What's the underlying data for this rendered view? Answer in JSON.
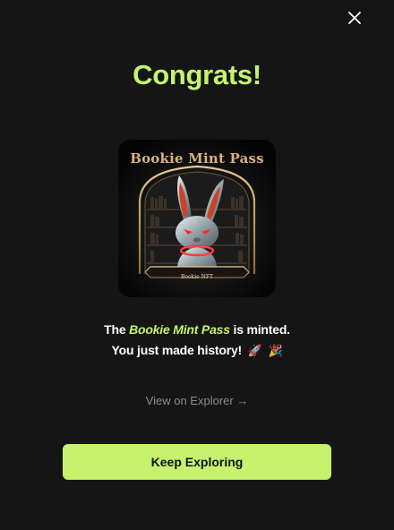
{
  "dialog": {
    "title": "Congrats!",
    "close_icon": "close-icon"
  },
  "nft": {
    "name": "Bookie Mint Pass",
    "banner_text": "Bookie NFT"
  },
  "message": {
    "prefix": "The",
    "highlight": "Bookie Mint Pass",
    "suffix": "is minted.",
    "line2": "You just made history!",
    "emoji_1": "🚀",
    "emoji_2": "🎉"
  },
  "links": {
    "explorer": "View on Explorer →"
  },
  "cta": {
    "label": "Keep Exploring"
  },
  "colors": {
    "background": "#151515",
    "accent": "#c6f26e",
    "muted_text": "#8c8c8c"
  }
}
